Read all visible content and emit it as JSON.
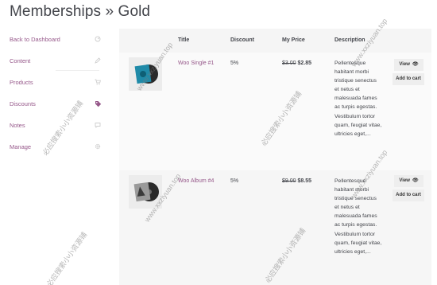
{
  "page": {
    "title": "Memberships » Gold"
  },
  "sidebar": {
    "items": [
      {
        "label": "Back to Dashboard",
        "icon": "dashboard-icon",
        "active": false
      },
      {
        "label": "Content",
        "icon": "pencil-icon",
        "active": false
      },
      {
        "label": "Products",
        "icon": "cart-icon",
        "active": false
      },
      {
        "label": "Discounts",
        "icon": "tag-icon",
        "active": true
      },
      {
        "label": "Notes",
        "icon": "comment-icon",
        "active": false
      },
      {
        "label": "Manage",
        "icon": "gear-icon",
        "active": false
      }
    ]
  },
  "table": {
    "headers": {
      "title": "Title",
      "discount": "Discount",
      "price": "My Price",
      "description": "Description"
    },
    "rows": [
      {
        "title": "Woo Single #1",
        "discount": "5%",
        "old_price": "$3.00",
        "new_price": "$2.85",
        "description": "Pellentesque habitant morbi tristique senectus et netus et malesuada fames ac turpis egestas. Vestibulum tortor quam, feugiat vitae, ultricies eget,...",
        "view_label": "View",
        "cart_label": "Add to cart"
      },
      {
        "title": "Woo Album #4",
        "discount": "5%",
        "old_price": "$9.00",
        "new_price": "$8.55",
        "description": "Pellentesque habitant morbi tristique senectus et netus et malesuada fames ac turpis egestas. Vestibulum tortor quam, feugiat vitae, ultricies eget,...",
        "view_label": "View",
        "cart_label": "Add to cart"
      }
    ]
  },
  "watermarks": {
    "site": "www.xxziyuan.top",
    "cn": "必应搜索小小资源铺"
  },
  "colors": {
    "accent": "#96588a",
    "text": "#43454b"
  }
}
